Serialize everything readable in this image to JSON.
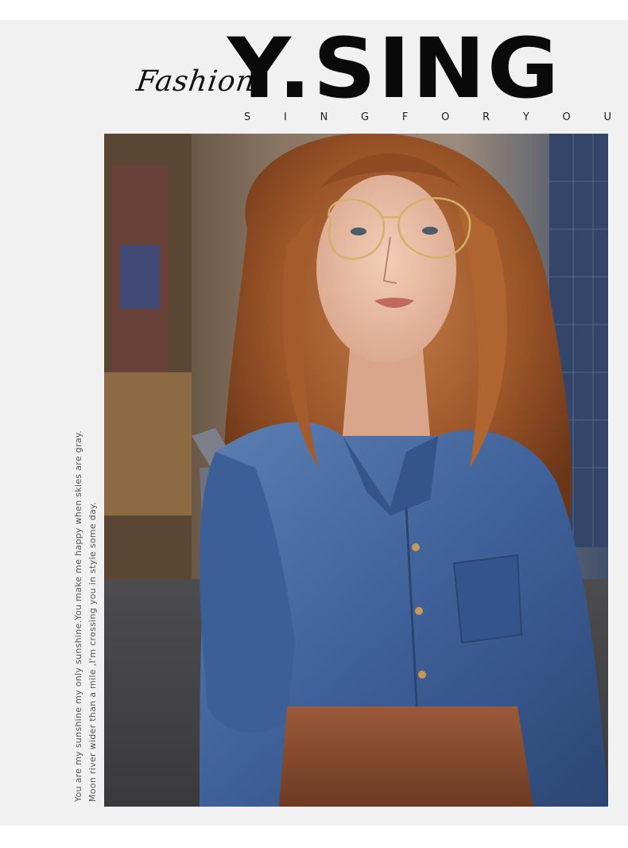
{
  "brand": {
    "script_word": "Fashion",
    "logo": "Y.SING",
    "tagline": [
      "S",
      "I",
      "N",
      "G",
      "",
      "F",
      "O",
      "R",
      "",
      "Y",
      "O",
      "U"
    ]
  },
  "side_caption": {
    "line1": "You are my sunshine my only sunshine.You make me happy when skies are gray.",
    "line2": "Moon river wider than a mile ,I'm crossing you in style some day."
  },
  "photo": {
    "subject": "woman-denim-shirt-gold-glasses"
  },
  "colors": {
    "panel_bg": "#f1f1f1",
    "logo": "#0a0a0a"
  }
}
